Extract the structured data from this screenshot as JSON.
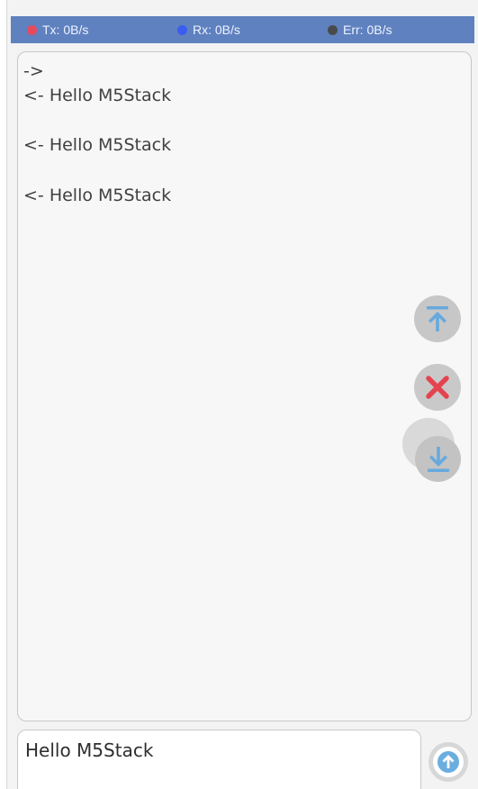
{
  "status": {
    "tx": {
      "label": "Tx: 0B/s",
      "dot_color": "#e8495c"
    },
    "rx": {
      "label": "Rx: 0B/s",
      "dot_color": "#3a5cf2"
    },
    "err": {
      "label": "Err: 0B/s",
      "dot_color": "#4a4a4a"
    }
  },
  "log": {
    "lines": [
      "->",
      "<- Hello M5Stack",
      "<- Hello M5Stack",
      "<- Hello M5Stack"
    ]
  },
  "actions": {
    "scroll_top_icon": "arrow-to-top-icon",
    "clear_icon": "close-icon",
    "scroll_bottom_icon": "arrow-to-bottom-icon"
  },
  "input": {
    "value": "Hello M5Stack"
  },
  "send": {
    "icon": "arrow-up-icon"
  },
  "colors": {
    "header_bg": "#5f81bf",
    "icon_blue": "#67a9dd",
    "clear_red": "#e5434f"
  }
}
